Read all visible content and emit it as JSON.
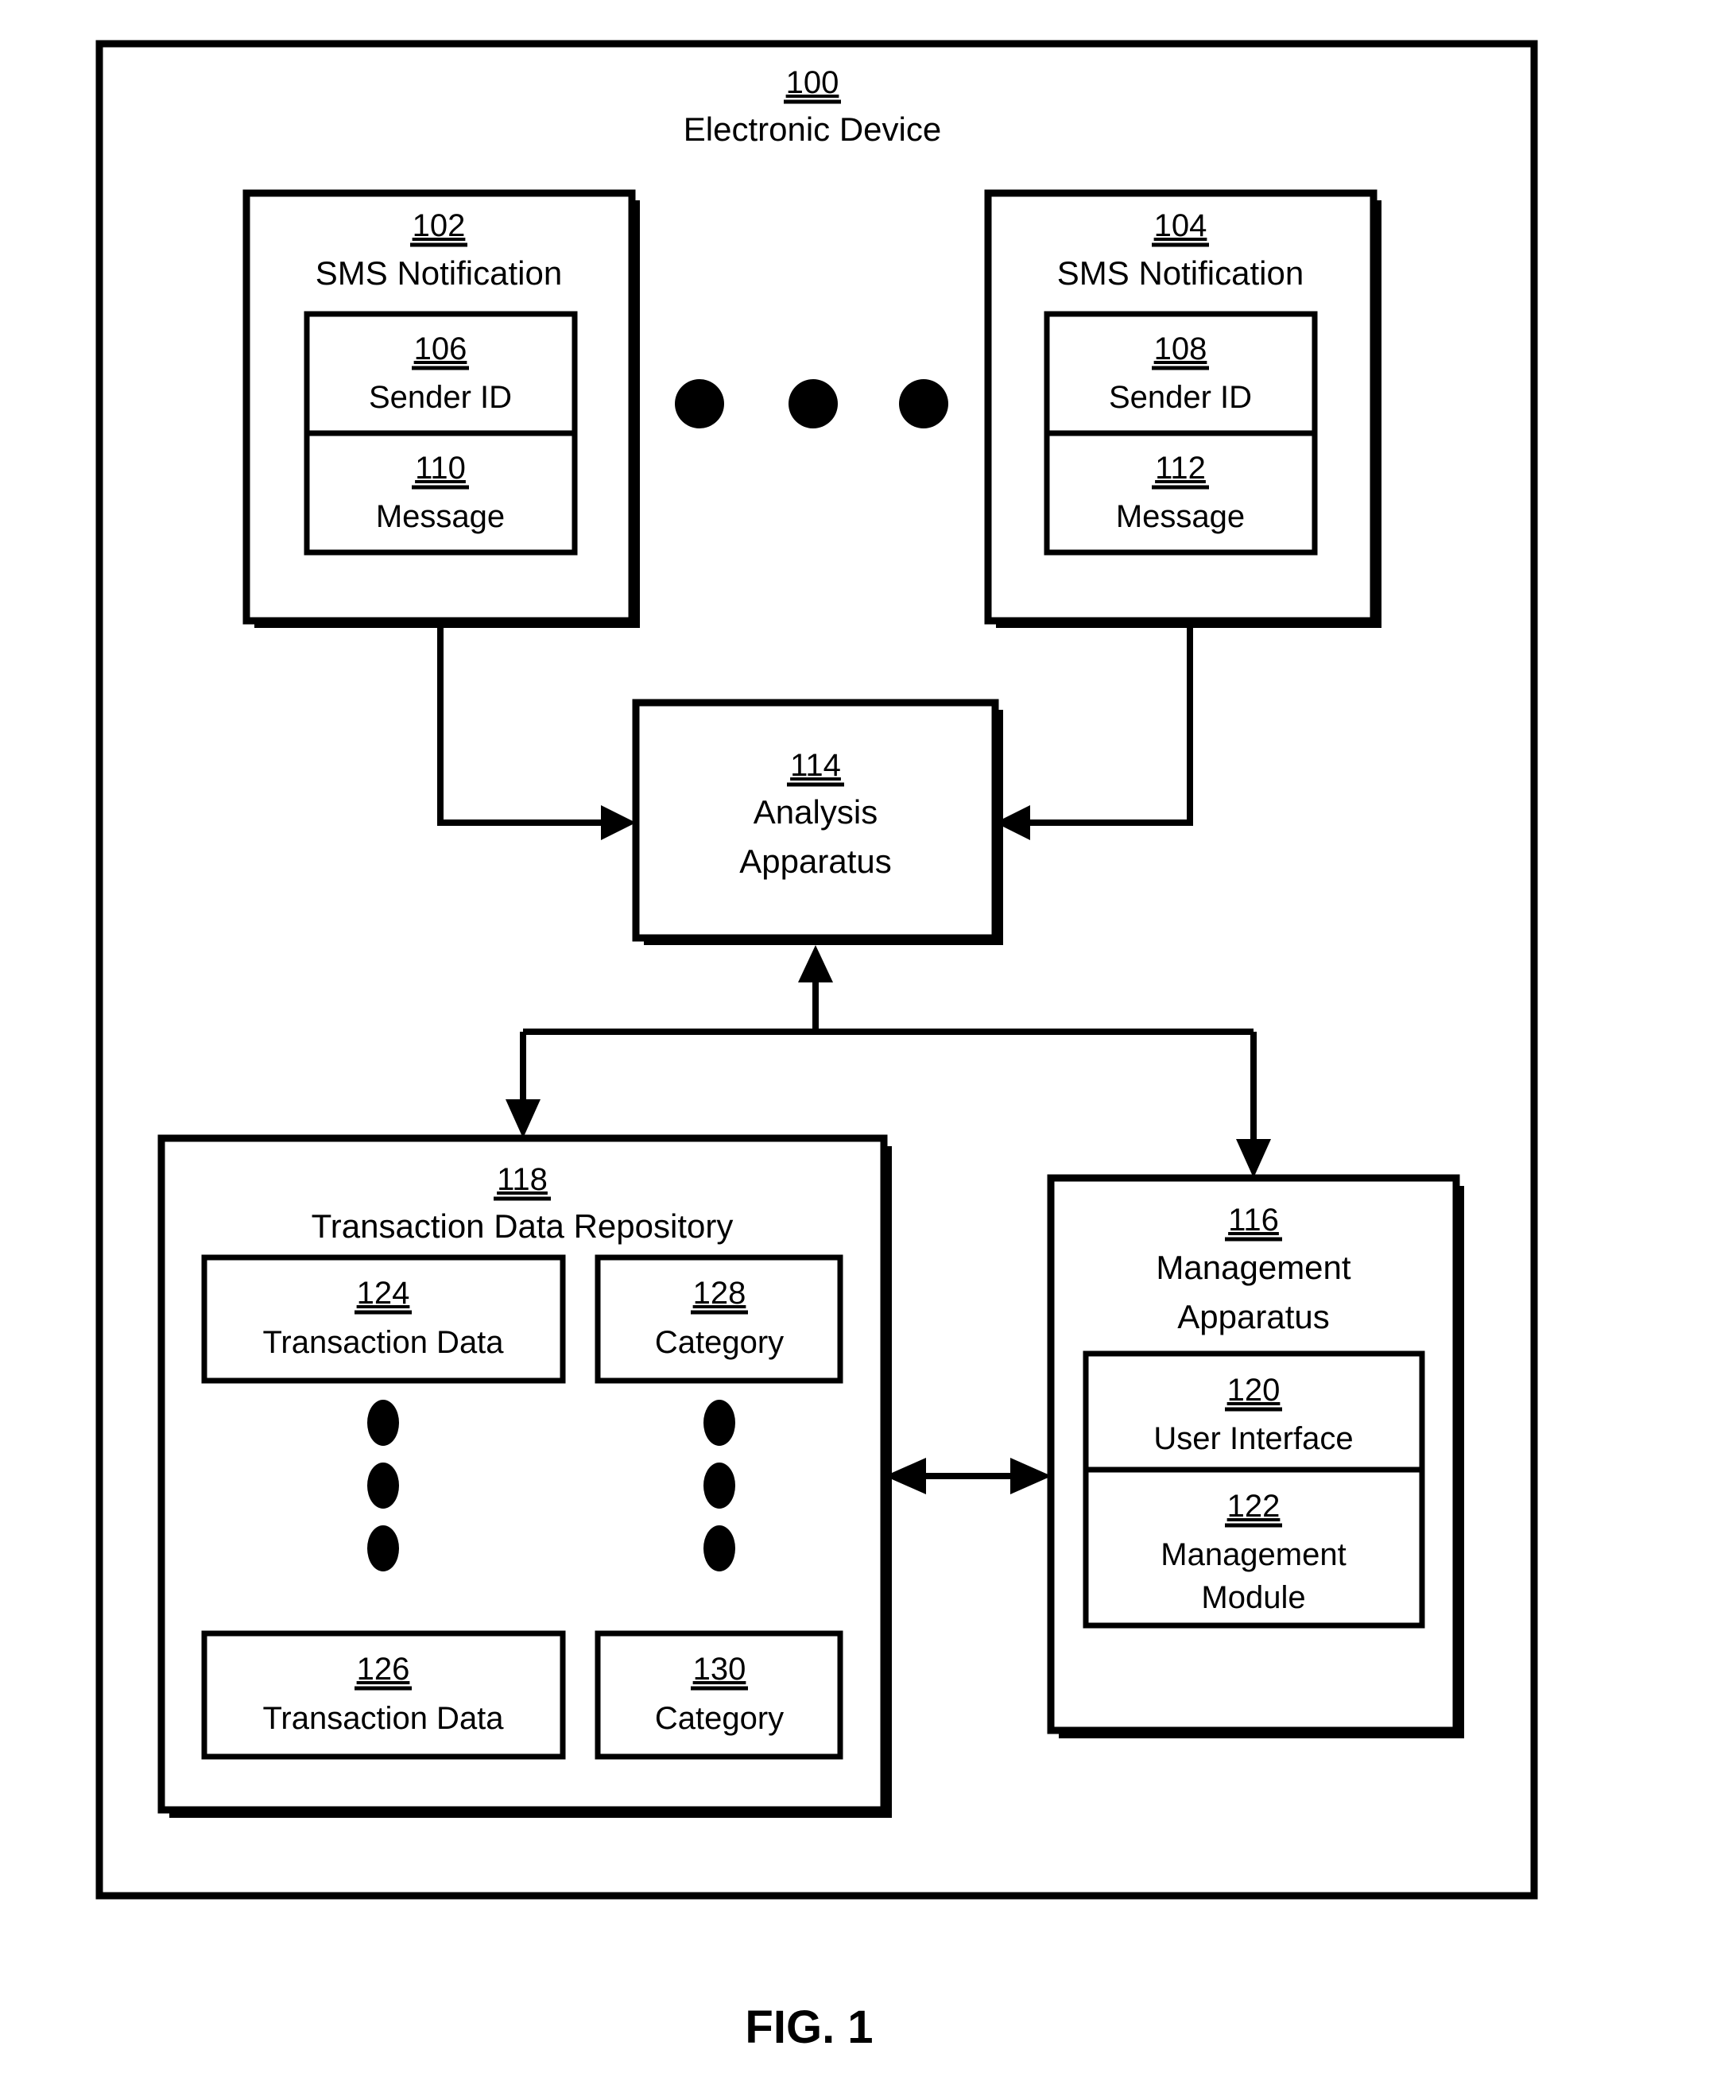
{
  "figure": {
    "caption": "FIG. 1"
  },
  "outer": {
    "ref": "100",
    "label": "Electronic Device"
  },
  "sms_left": {
    "ref": "102",
    "label": "SMS Notification",
    "sender": {
      "ref": "106",
      "label": "Sender ID"
    },
    "message": {
      "ref": "110",
      "label": "Message"
    }
  },
  "sms_right": {
    "ref": "104",
    "label": "SMS Notification",
    "sender": {
      "ref": "108",
      "label": "Sender ID"
    },
    "message": {
      "ref": "112",
      "label": "Message"
    }
  },
  "ellipsis_top": {
    "name": "horizontal-ellipsis",
    "count": 3
  },
  "analysis": {
    "ref": "114",
    "label_line1": "Analysis",
    "label_line2": "Apparatus"
  },
  "repository": {
    "ref": "118",
    "label": "Transaction Data Repository",
    "txn_first": {
      "ref": "124",
      "label": "Transaction Data"
    },
    "txn_last": {
      "ref": "126",
      "label": "Transaction Data"
    },
    "cat_first": {
      "ref": "128",
      "label": "Category"
    },
    "cat_last": {
      "ref": "130",
      "label": "Category"
    },
    "ellipsis_txn": {
      "name": "vertical-ellipsis",
      "count": 3
    },
    "ellipsis_cat": {
      "name": "vertical-ellipsis",
      "count": 3
    }
  },
  "management": {
    "ref": "116",
    "label_line1": "Management",
    "label_line2": "Apparatus",
    "user_interface": {
      "ref": "120",
      "label": "User Interface"
    },
    "management_module": {
      "ref": "122",
      "label_line1": "Management",
      "label_line2": "Module"
    }
  },
  "colors": {
    "ink": "#000000",
    "paper": "#ffffff"
  }
}
